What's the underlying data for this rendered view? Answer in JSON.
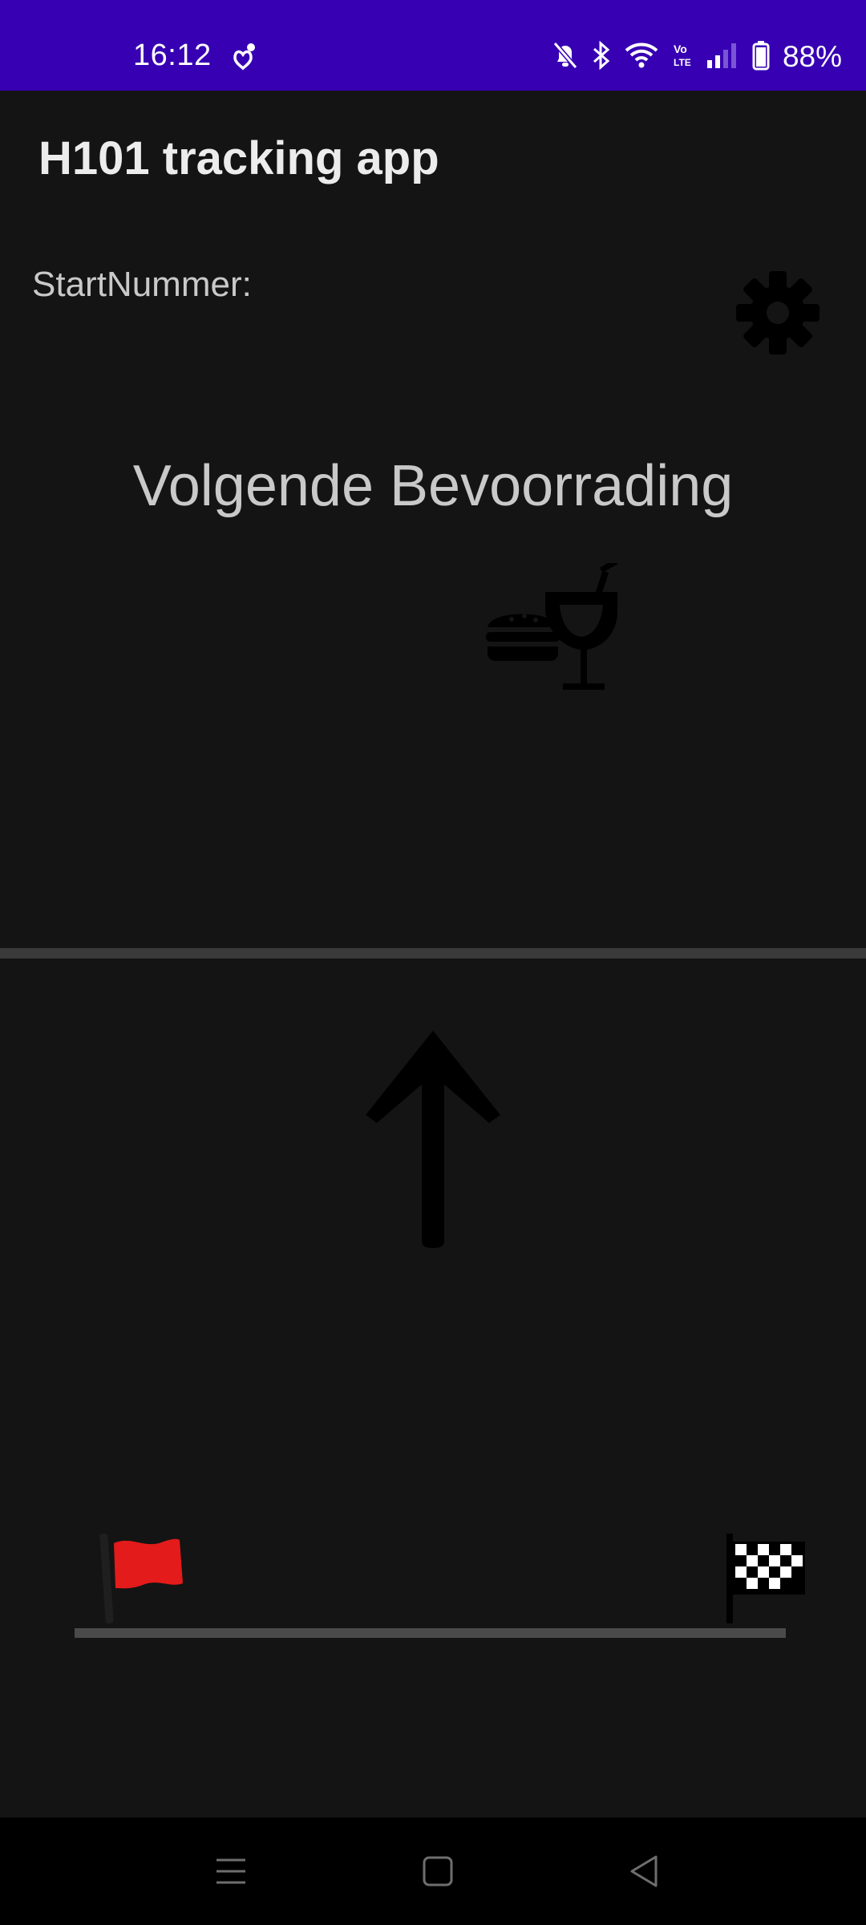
{
  "status_bar": {
    "time": "16:12",
    "battery": "88%",
    "icons": [
      "notification-heart-icon",
      "mute-icon",
      "bluetooth-icon",
      "wifi-icon",
      "volte-icon",
      "signal-icon",
      "battery-icon"
    ],
    "background": "#3700b3"
  },
  "app": {
    "title": "H101 tracking app"
  },
  "main": {
    "start_number_label": "StartNummer:",
    "settings_icon": "gear-icon",
    "next_title": "Volgende Bevoorrading",
    "supply_icon": "food-drink-icon",
    "direction_icon": "arrow-up-icon"
  },
  "progress": {
    "start_icon": "red-flag-icon",
    "finish_icon": "checkered-flag-icon",
    "start_flag_color": "#e31b1b"
  },
  "nav_bar": {
    "icons": [
      "menu-icon",
      "home-icon",
      "back-icon"
    ]
  }
}
